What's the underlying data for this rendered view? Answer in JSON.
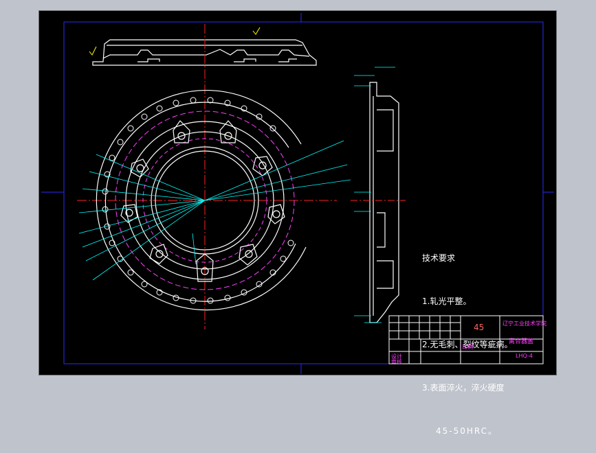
{
  "technical_requirements": {
    "title": "技术要求",
    "items": [
      "1.轧光平整。",
      "2.无毛刺、裂纹等疵病。",
      "3.表面淬火，淬火硬度"
    ],
    "hardness": "45-50HRC。"
  },
  "title_block": {
    "material": "45",
    "school": "辽宁工业技术学院",
    "part_name": "离合器盖",
    "drawing_no": "LHQ-4",
    "design_label": "设计",
    "scale_label": "比例",
    "checker_label": "审核"
  },
  "colors": {
    "background": "#000000",
    "outline": "#ffffff",
    "frame": "#2020ff",
    "centerline": "#ff2020",
    "dimension": "#00ffff",
    "hidden": "#ff40ff",
    "accent": "#ffff00"
  }
}
